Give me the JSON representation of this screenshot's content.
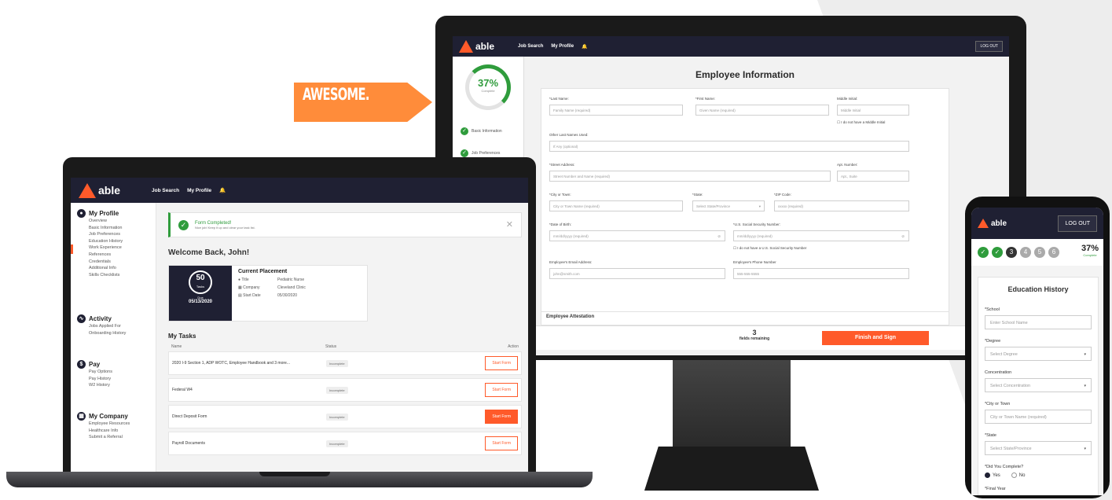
{
  "brand": {
    "logo_text": "able",
    "accent": "#ff5a2a",
    "navy": "#1f2033",
    "success": "#2f9c3c"
  },
  "callout": {
    "text": "AWESOME."
  },
  "monitor": {
    "nav": {
      "job_search": "Job Search",
      "my_profile": "My Profile",
      "logout": "LOG OUT"
    },
    "progress": {
      "percent": "37%",
      "label": "Complete"
    },
    "steps": [
      {
        "label": "Basic Information"
      },
      {
        "label": "Job Preferences"
      }
    ],
    "form_title": "Employee Information",
    "fields": {
      "last_name_label": "*Last Name:",
      "last_name_ph": "Family Name (required)",
      "first_name_label": "*First Name:",
      "first_name_ph": "Given Name (required)",
      "mi_label": "Middle Initial:",
      "mi_ph": "Middle Initial",
      "no_mi": "I do not have a Middle Initial",
      "other_last_label": "Other Last Names Used:",
      "other_last_ph": "If Any (optional)",
      "street_label": "*Street Address:",
      "street_ph": "Street Number and Name (required)",
      "apt_label": "Apt. Number:",
      "apt_ph": "Apt., Suite",
      "city_label": "*City or Town:",
      "city_ph": "City or Town Name (required)",
      "state_label": "*State:",
      "state_ph": "Select State/Province",
      "zip_label": "*ZIP Code:",
      "zip_ph": "xxxxx (required)",
      "dob_label": "*Date of Birth:",
      "dob_ph": "mm/dd/yyyy (required)",
      "ssn_label": "*U.S. Social Security Number:",
      "ssn_ph": "mm/dd/yyyy (required)",
      "no_ssn": "I do not have a U.S. Social Security Number",
      "email_label": "Employee's Email Address:",
      "email_ph": "john@smith.com",
      "phone_label": "Employee's Phone Number",
      "phone_ph": "555-555-5555"
    },
    "attestation": "Employee Attestation",
    "remaining_count": "3",
    "remaining_label": "fields remaining",
    "finish_button": "Finish and Sign"
  },
  "laptop": {
    "nav": {
      "job_search": "Job Search",
      "my_profile": "My Profile"
    },
    "sidebar": {
      "my_profile": {
        "title": "My Profile",
        "items": [
          "Overview",
          "Basic Information",
          "Job Preferences",
          "Education History",
          "Work Experience",
          "References",
          "Credentials",
          "Additional Info",
          "Skills Checklists"
        ]
      },
      "activity": {
        "title": "Activity",
        "items": [
          "Jobs Applied For",
          "Onboarding History"
        ]
      },
      "pay": {
        "title": "Pay",
        "items": [
          "Pay Options",
          "Pay History",
          "W2 History"
        ]
      },
      "my_company": {
        "title": "My Company",
        "items": [
          "Employee Resources",
          "Healthcare Info",
          "Submit a Referral"
        ]
      }
    },
    "toast": {
      "title": "Form Completed!",
      "subtitle": "Nice job! Keep it up and clear your task list."
    },
    "welcome": "Welcome Back, John!",
    "placement": {
      "tasks_count": "50",
      "tasks_label": "Tasks",
      "date_label": "Due",
      "date": "05/13/2020",
      "title": "Current Placement",
      "rows": [
        {
          "k": "Title",
          "v": "Pediatric Nurse"
        },
        {
          "k": "Company",
          "v": "Cleveland Clinic"
        },
        {
          "k": "Start Date",
          "v": "05/30/2020"
        }
      ]
    },
    "tasks": {
      "title": "My Tasks",
      "headers": {
        "name": "Name",
        "status": "Status",
        "action": "Action"
      },
      "rows": [
        {
          "name": "2020 I-9 Section 1, ADP WOTC, Employee Handbook and 3 more...",
          "status": "Incomplete",
          "action": "Start Form"
        },
        {
          "name": "Federal W4",
          "status": "Incomplete",
          "action": "Start Form"
        },
        {
          "name": "Direct Deposit Form",
          "status": "Incomplete",
          "action": "Start Form"
        },
        {
          "name": "Payroll Documents",
          "status": "Incomplete",
          "action": "Start Form"
        }
      ]
    }
  },
  "phone": {
    "logout": "LOG OUT",
    "steps": [
      "✓",
      "✓",
      "3",
      "4",
      "5",
      "6"
    ],
    "percent": "37%",
    "percent_label": "Complete",
    "title": "Education History",
    "school_label": "*School",
    "school_ph": "Enter School Name",
    "degree_label": "*Degree",
    "degree_ph": "Select Degree",
    "conc_label": "Concentration",
    "conc_ph": "Select Concentration",
    "city_label": "*City or Town",
    "city_ph": "City or Town Name (required)",
    "state_label": "*State",
    "state_ph": "Select State/Province",
    "complete_label": "*Did You Complete?",
    "yes": "Yes",
    "no": "No",
    "final_year_label": "*Final Year"
  }
}
